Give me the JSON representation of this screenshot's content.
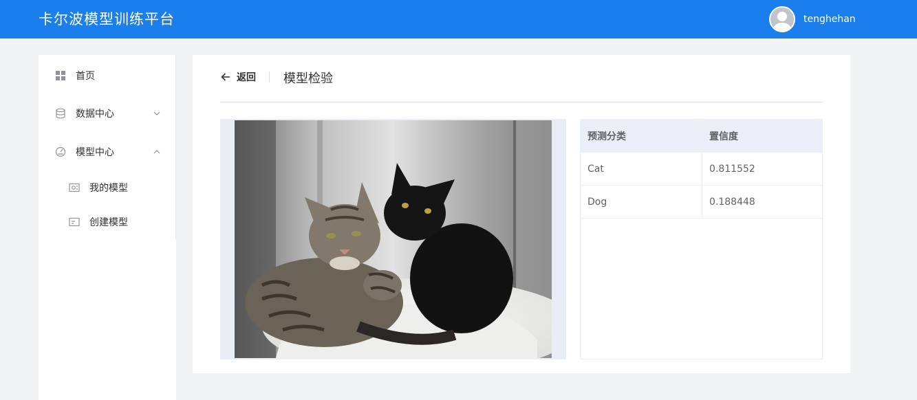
{
  "header": {
    "brand": "卡尔波模型训练平台",
    "username": "tenghehan",
    "accent_color": "#1a7eec"
  },
  "sidebar": {
    "items": [
      {
        "label": "首页",
        "icon": "grid-icon"
      },
      {
        "label": "数据中心",
        "icon": "database-icon",
        "expanded": false
      },
      {
        "label": "模型中心",
        "icon": "gauge-icon",
        "expanded": true,
        "children": [
          {
            "label": "我的模型",
            "icon": "model-card-icon"
          },
          {
            "label": "创建模型",
            "icon": "create-card-icon"
          }
        ]
      }
    ]
  },
  "main": {
    "back_label": "返回",
    "page_title": "模型检验",
    "image_alt": "two cats lying together — a tabby and a black cat",
    "table": {
      "columns": [
        "预测分类",
        "置信度"
      ],
      "rows": [
        {
          "class": "Cat",
          "confidence": "0.811552"
        },
        {
          "class": "Dog",
          "confidence": "0.188448"
        }
      ]
    }
  }
}
